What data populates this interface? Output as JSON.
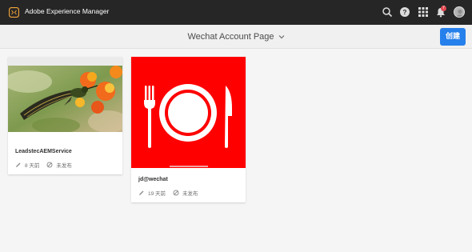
{
  "header": {
    "app_title": "Adobe Experience Manager",
    "notification_count": "7",
    "icons": [
      "aem-logo-icon",
      "search-icon",
      "help-icon",
      "apps-grid-icon",
      "bell-icon",
      "user-avatar"
    ]
  },
  "subheader": {
    "page_title": "Wechat Account Page",
    "create_label": "创建"
  },
  "cards": [
    {
      "title": "LeadstecAEMService",
      "modified": "8 天前",
      "status": "未发布",
      "thumbnail": "hummingbird-flowers-photo"
    },
    {
      "title": "jd@wechat",
      "modified": "19 天前",
      "status": "未发布",
      "thumbnail": "plate-fork-knife-icon"
    }
  ],
  "colors": {
    "topbar": "#262626",
    "accent": "#2680eb",
    "badge": "#e34850",
    "thumbnail_red": "#ff0000"
  }
}
